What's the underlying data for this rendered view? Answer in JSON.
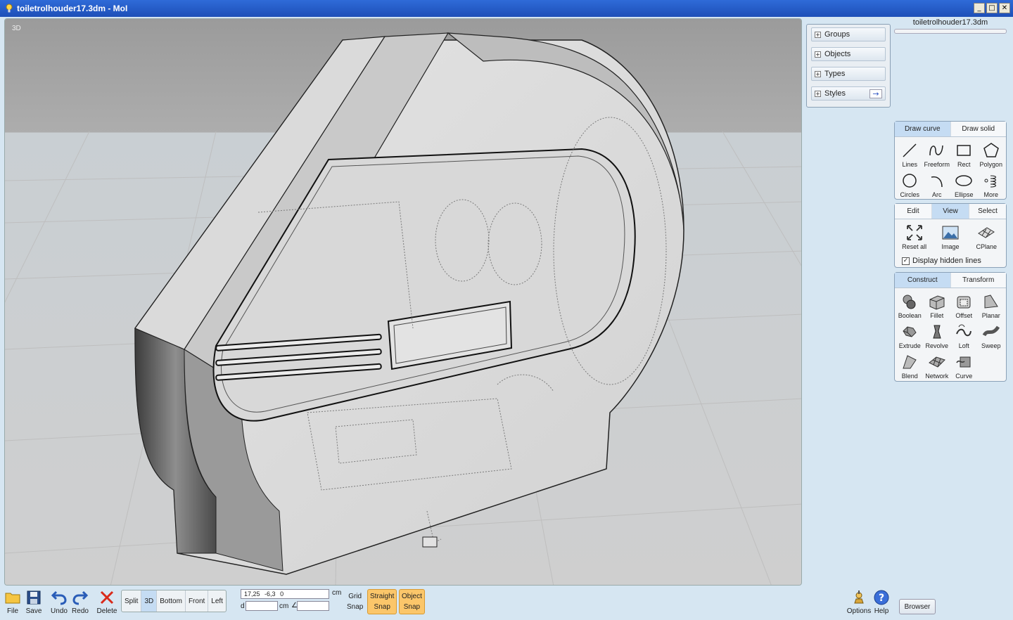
{
  "window": {
    "title": "toiletrolhouder17.3dm - MoI",
    "controls": [
      "_",
      "□",
      "✕"
    ]
  },
  "viewport": {
    "label": "3D"
  },
  "scene_browser": {
    "items": [
      {
        "label": "Groups",
        "icon": "plus-icon"
      },
      {
        "label": "Objects",
        "icon": "plus-icon"
      },
      {
        "label": "Types",
        "icon": "plus-icon"
      },
      {
        "label": "Styles",
        "icon": "plus-icon",
        "action": "→"
      }
    ]
  },
  "file_name": "toiletrolhouder17.3dm",
  "draw_palette": {
    "tabs": [
      {
        "label": "Draw curve",
        "active": true
      },
      {
        "label": "Draw solid",
        "active": false
      }
    ],
    "tools": [
      {
        "label": "Lines",
        "icon": "lines-icon"
      },
      {
        "label": "Freeform",
        "icon": "freeform-icon"
      },
      {
        "label": "Rect",
        "icon": "rect-icon"
      },
      {
        "label": "Polygon",
        "icon": "polygon-icon"
      },
      {
        "label": "Circles",
        "icon": "circle-icon"
      },
      {
        "label": "Arc",
        "icon": "arc-icon"
      },
      {
        "label": "Ellipse",
        "icon": "ellipse-icon"
      },
      {
        "label": "More",
        "icon": "more-icon"
      }
    ]
  },
  "view_palette": {
    "tabs": [
      {
        "label": "Edit",
        "active": false
      },
      {
        "label": "View",
        "active": true
      },
      {
        "label": "Select",
        "active": false
      }
    ],
    "tools": [
      {
        "label": "Reset all",
        "icon": "reset-all-icon"
      },
      {
        "label": "Image",
        "icon": "image-icon"
      },
      {
        "label": "CPlane",
        "icon": "cplane-icon"
      }
    ],
    "checkbox_label": "Display hidden lines",
    "checkbox_mark": "✓"
  },
  "construct_palette": {
    "tabs": [
      {
        "label": "Construct",
        "active": true
      },
      {
        "label": "Transform",
        "active": false
      }
    ],
    "tools": [
      {
        "label": "Boolean",
        "icon": "boolean-icon"
      },
      {
        "label": "Fillet",
        "icon": "fillet-icon"
      },
      {
        "label": "Offset",
        "icon": "offset-icon"
      },
      {
        "label": "Planar",
        "icon": "planar-icon"
      },
      {
        "label": "Extrude",
        "icon": "extrude-icon"
      },
      {
        "label": "Revolve",
        "icon": "revolve-icon"
      },
      {
        "label": "Loft",
        "icon": "loft-icon"
      },
      {
        "label": "Sweep",
        "icon": "sweep-icon"
      },
      {
        "label": "Blend",
        "icon": "blend-icon"
      },
      {
        "label": "Network",
        "icon": "network-icon"
      },
      {
        "label": "Curve",
        "icon": "curve-icon"
      }
    ]
  },
  "bottom_toolbar": {
    "file": {
      "label": "File",
      "icon": "folder-icon"
    },
    "save": {
      "label": "Save",
      "icon": "save-icon"
    },
    "undo": {
      "label": "Undo",
      "icon": "undo-icon"
    },
    "redo": {
      "label": "Redo",
      "icon": "redo-icon"
    },
    "delete": {
      "label": "Delete",
      "icon": "delete-icon"
    },
    "views": [
      {
        "label": "Split",
        "active": false
      },
      {
        "label": "3D",
        "active": true
      },
      {
        "label": "Bottom",
        "active": false
      },
      {
        "label": "Front",
        "active": false
      },
      {
        "label": "Left",
        "active": false
      }
    ],
    "coords": {
      "x": "17,25",
      "y": "-6,3",
      "z": "0",
      "unit": "cm",
      "d_label": "d",
      "d_unit": "cm",
      "angle_label": "∠"
    },
    "grid_snap": {
      "line1": "Grid",
      "line2": "Snap",
      "active": false
    },
    "straight_snap": {
      "line1": "Straight",
      "line2": "Snap",
      "active": true
    },
    "object_snap": {
      "line1": "Object",
      "line2": "Snap",
      "active": true
    },
    "options": {
      "label": "Options",
      "icon": "options-icon"
    },
    "help": {
      "label": "Help",
      "icon": "help-icon"
    },
    "browser": {
      "label": "Browser"
    }
  },
  "colors": {
    "title_bar": "#1d4fb8",
    "background": "#d6e6f2",
    "active_tab": "#c5dcf3",
    "snap_active": "#fbc66a"
  }
}
